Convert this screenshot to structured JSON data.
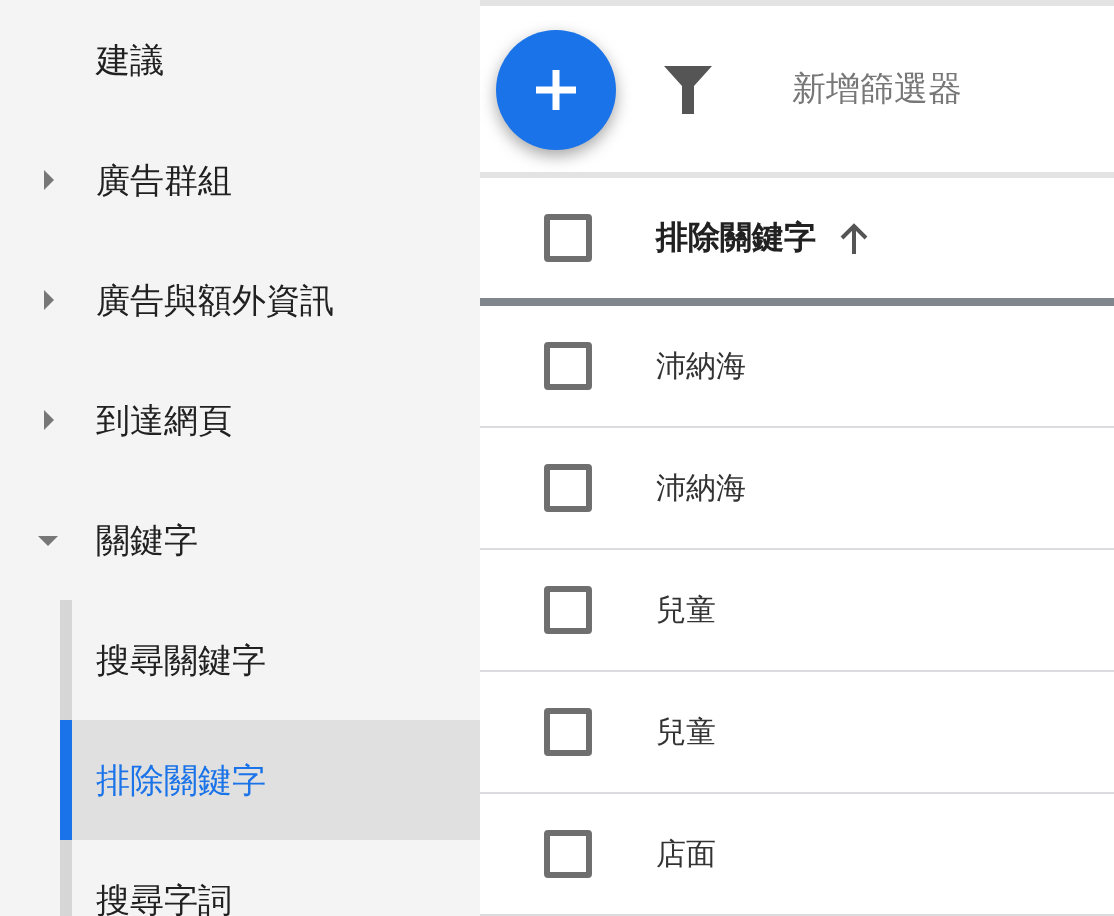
{
  "sidebar": {
    "items": [
      {
        "label": "建議",
        "selected": false
      },
      {
        "label": "廣告群組",
        "selected": false,
        "expanded": false
      },
      {
        "label": "廣告與額外資訊",
        "selected": false,
        "expanded": false
      },
      {
        "label": "到達網頁",
        "selected": false,
        "expanded": false
      },
      {
        "label": "關鍵字",
        "selected": false,
        "expanded": true,
        "children": [
          {
            "label": "搜尋關鍵字",
            "selected": false
          },
          {
            "label": "排除關鍵字",
            "selected": true
          },
          {
            "label": "搜尋字詞",
            "selected": false
          }
        ]
      }
    ]
  },
  "toolbar": {
    "filter": {
      "placeholder": "新增篩選器"
    }
  },
  "table": {
    "header_checked": false,
    "columns": [
      {
        "label": "排除關鍵字",
        "sort_ascending": true
      }
    ],
    "rows": [
      {
        "keyword": "沛納海",
        "checked": false
      },
      {
        "keyword": "沛納海",
        "checked": false
      },
      {
        "keyword": "兒童",
        "checked": false
      },
      {
        "keyword": "兒童",
        "checked": false
      },
      {
        "keyword": "店面",
        "checked": false
      }
    ]
  }
}
